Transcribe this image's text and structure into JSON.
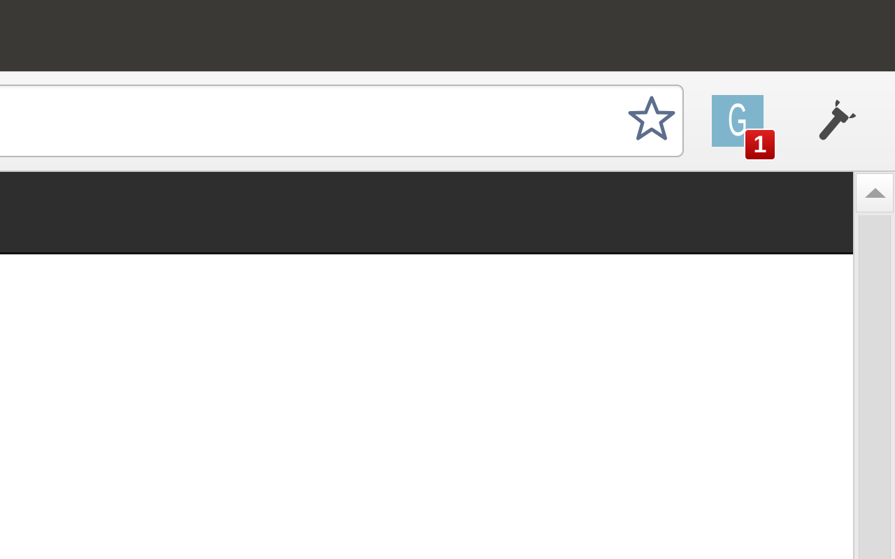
{
  "browser": {
    "omnibox": {
      "value": "",
      "placeholder": ""
    },
    "extension": {
      "letter": "G",
      "badge_count": "1",
      "tile_color": "#7fb5cc",
      "badge_color": "#c80000"
    },
    "icons": {
      "bookmark": "star-icon",
      "settings": "wrench-icon",
      "scroll_up": "up-arrow-icon"
    }
  },
  "page": {
    "header_color": "#2e2e2e",
    "body_color": "#ffffff"
  }
}
